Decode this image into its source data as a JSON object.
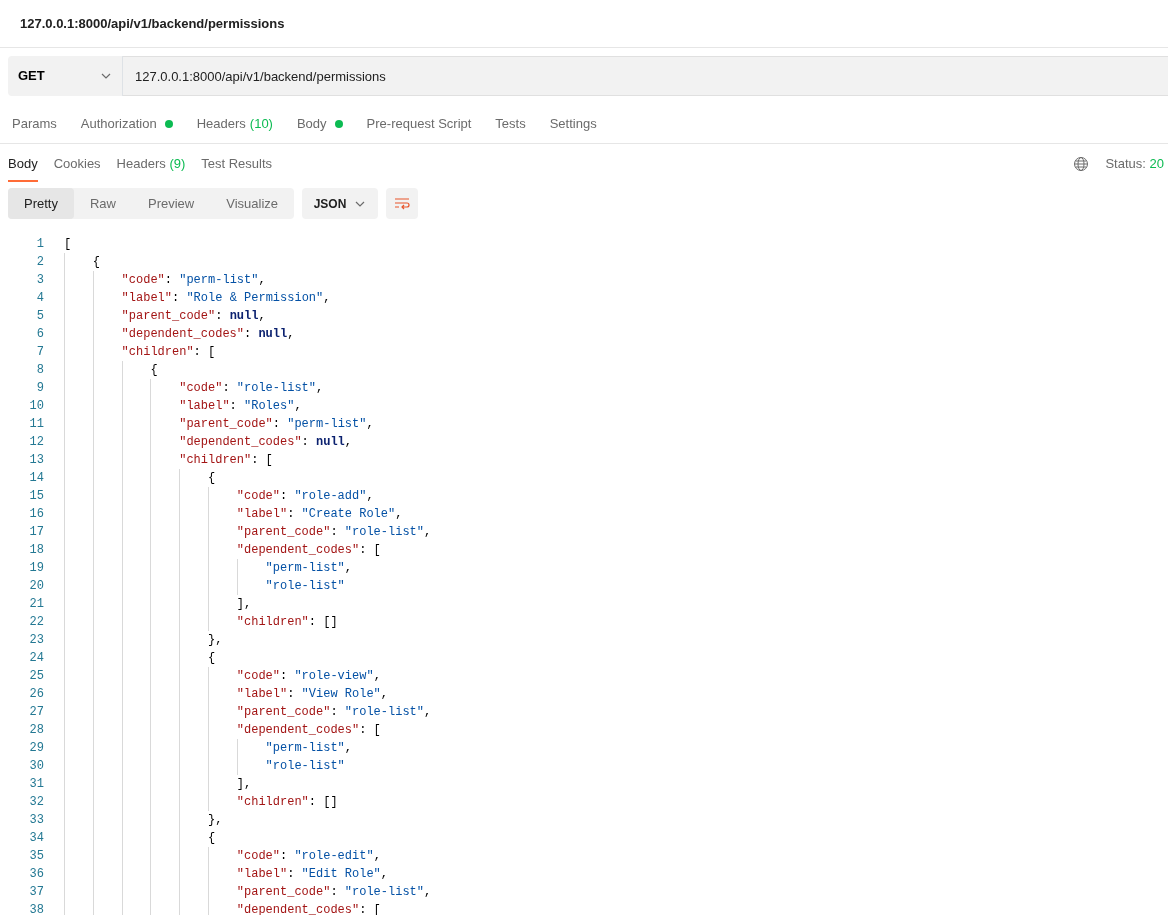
{
  "window": {
    "title": "127.0.0.1:8000/api/v1/backend/permissions"
  },
  "request": {
    "method": "GET",
    "url": "127.0.0.1:8000/api/v1/backend/permissions"
  },
  "request_tabs": [
    {
      "label": "Params",
      "has_dot": false
    },
    {
      "label": "Authorization",
      "has_dot": true
    },
    {
      "label": "Headers",
      "count": "(10)",
      "has_dot": false
    },
    {
      "label": "Body",
      "has_dot": true
    },
    {
      "label": "Pre-request Script",
      "has_dot": false
    },
    {
      "label": "Tests",
      "has_dot": false
    },
    {
      "label": "Settings",
      "has_dot": false
    }
  ],
  "response_tabs": [
    {
      "label": "Body",
      "selected": true
    },
    {
      "label": "Cookies",
      "selected": false
    },
    {
      "label": "Headers",
      "count": "(9)",
      "selected": false
    },
    {
      "label": "Test Results",
      "selected": false
    }
  ],
  "status": {
    "label": "Status:",
    "value": "20"
  },
  "view_modes": [
    {
      "label": "Pretty",
      "selected": true
    },
    {
      "label": "Raw",
      "selected": false
    },
    {
      "label": "Preview",
      "selected": false
    },
    {
      "label": "Visualize",
      "selected": false
    }
  ],
  "format": "JSON",
  "code_lines": [
    {
      "number": "1",
      "text": "["
    },
    {
      "number": "2",
      "text": "    {"
    },
    {
      "number": "3",
      "text": "        \"code\": \"perm-list\","
    },
    {
      "number": "4",
      "text": "        \"label\": \"Role & Permission\","
    },
    {
      "number": "5",
      "text": "        \"parent_code\": null,"
    },
    {
      "number": "6",
      "text": "        \"dependent_codes\": null,"
    },
    {
      "number": "7",
      "text": "        \"children\": ["
    },
    {
      "number": "8",
      "text": "            {"
    },
    {
      "number": "9",
      "text": "                \"code\": \"role-list\","
    },
    {
      "number": "10",
      "text": "                \"label\": \"Roles\","
    },
    {
      "number": "11",
      "text": "                \"parent_code\": \"perm-list\","
    },
    {
      "number": "12",
      "text": "                \"dependent_codes\": null,"
    },
    {
      "number": "13",
      "text": "                \"children\": ["
    },
    {
      "number": "14",
      "text": "                    {"
    },
    {
      "number": "15",
      "text": "                        \"code\": \"role-add\","
    },
    {
      "number": "16",
      "text": "                        \"label\": \"Create Role\","
    },
    {
      "number": "17",
      "text": "                        \"parent_code\": \"role-list\","
    },
    {
      "number": "18",
      "text": "                        \"dependent_codes\": ["
    },
    {
      "number": "19",
      "text": "                            \"perm-list\","
    },
    {
      "number": "20",
      "text": "                            \"role-list\""
    },
    {
      "number": "21",
      "text": "                        ],"
    },
    {
      "number": "22",
      "text": "                        \"children\": []"
    },
    {
      "number": "23",
      "text": "                    },"
    },
    {
      "number": "24",
      "text": "                    {"
    },
    {
      "number": "25",
      "text": "                        \"code\": \"role-view\","
    },
    {
      "number": "26",
      "text": "                        \"label\": \"View Role\","
    },
    {
      "number": "27",
      "text": "                        \"parent_code\": \"role-list\","
    },
    {
      "number": "28",
      "text": "                        \"dependent_codes\": ["
    },
    {
      "number": "29",
      "text": "                            \"perm-list\","
    },
    {
      "number": "30",
      "text": "                            \"role-list\""
    },
    {
      "number": "31",
      "text": "                        ],"
    },
    {
      "number": "32",
      "text": "                        \"children\": []"
    },
    {
      "number": "33",
      "text": "                    },"
    },
    {
      "number": "34",
      "text": "                    {"
    },
    {
      "number": "35",
      "text": "                        \"code\": \"role-edit\","
    },
    {
      "number": "36",
      "text": "                        \"label\": \"Edit Role\","
    },
    {
      "number": "37",
      "text": "                        \"parent_code\": \"role-list\","
    },
    {
      "number": "38",
      "text": "                        \"dependent_codes\": ["
    }
  ]
}
